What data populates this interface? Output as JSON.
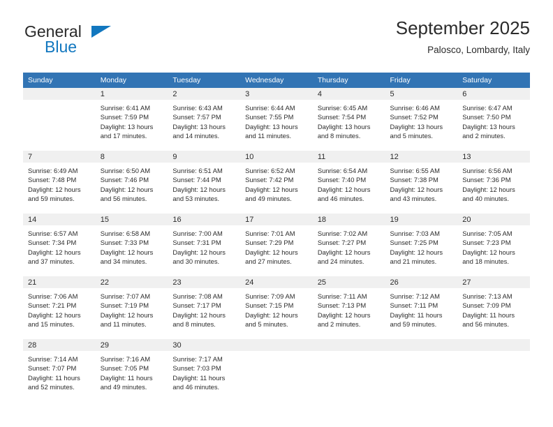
{
  "brand": {
    "word_top": "General",
    "word_bottom": "Blue",
    "triangle_color": "#1277bf",
    "text_color": "#2a2a2a"
  },
  "header": {
    "title": "September 2025",
    "subtitle": "Palosco, Lombardy, Italy"
  },
  "theme": {
    "header_blue": "#3274b4",
    "daynum_background": "#f0f0f0",
    "text": "#2b2b2b"
  },
  "weekday_headers": [
    "Sunday",
    "Monday",
    "Tuesday",
    "Wednesday",
    "Thursday",
    "Friday",
    "Saturday"
  ],
  "labels": {
    "sunrise_prefix": "Sunrise:",
    "sunset_prefix": "Sunset:",
    "daylight_prefix": "Daylight:"
  },
  "weeks": [
    [
      {
        "day": "",
        "line1": "",
        "line2": "",
        "line3": "",
        "line4": ""
      },
      {
        "day": "1",
        "line1": "Sunrise: 6:41 AM",
        "line2": "Sunset: 7:59 PM",
        "line3": "Daylight: 13 hours",
        "line4": "and 17 minutes."
      },
      {
        "day": "2",
        "line1": "Sunrise: 6:43 AM",
        "line2": "Sunset: 7:57 PM",
        "line3": "Daylight: 13 hours",
        "line4": "and 14 minutes."
      },
      {
        "day": "3",
        "line1": "Sunrise: 6:44 AM",
        "line2": "Sunset: 7:55 PM",
        "line3": "Daylight: 13 hours",
        "line4": "and 11 minutes."
      },
      {
        "day": "4",
        "line1": "Sunrise: 6:45 AM",
        "line2": "Sunset: 7:54 PM",
        "line3": "Daylight: 13 hours",
        "line4": "and 8 minutes."
      },
      {
        "day": "5",
        "line1": "Sunrise: 6:46 AM",
        "line2": "Sunset: 7:52 PM",
        "line3": "Daylight: 13 hours",
        "line4": "and 5 minutes."
      },
      {
        "day": "6",
        "line1": "Sunrise: 6:47 AM",
        "line2": "Sunset: 7:50 PM",
        "line3": "Daylight: 13 hours",
        "line4": "and 2 minutes."
      }
    ],
    [
      {
        "day": "7",
        "line1": "Sunrise: 6:49 AM",
        "line2": "Sunset: 7:48 PM",
        "line3": "Daylight: 12 hours",
        "line4": "and 59 minutes."
      },
      {
        "day": "8",
        "line1": "Sunrise: 6:50 AM",
        "line2": "Sunset: 7:46 PM",
        "line3": "Daylight: 12 hours",
        "line4": "and 56 minutes."
      },
      {
        "day": "9",
        "line1": "Sunrise: 6:51 AM",
        "line2": "Sunset: 7:44 PM",
        "line3": "Daylight: 12 hours",
        "line4": "and 53 minutes."
      },
      {
        "day": "10",
        "line1": "Sunrise: 6:52 AM",
        "line2": "Sunset: 7:42 PM",
        "line3": "Daylight: 12 hours",
        "line4": "and 49 minutes."
      },
      {
        "day": "11",
        "line1": "Sunrise: 6:54 AM",
        "line2": "Sunset: 7:40 PM",
        "line3": "Daylight: 12 hours",
        "line4": "and 46 minutes."
      },
      {
        "day": "12",
        "line1": "Sunrise: 6:55 AM",
        "line2": "Sunset: 7:38 PM",
        "line3": "Daylight: 12 hours",
        "line4": "and 43 minutes."
      },
      {
        "day": "13",
        "line1": "Sunrise: 6:56 AM",
        "line2": "Sunset: 7:36 PM",
        "line3": "Daylight: 12 hours",
        "line4": "and 40 minutes."
      }
    ],
    [
      {
        "day": "14",
        "line1": "Sunrise: 6:57 AM",
        "line2": "Sunset: 7:34 PM",
        "line3": "Daylight: 12 hours",
        "line4": "and 37 minutes."
      },
      {
        "day": "15",
        "line1": "Sunrise: 6:58 AM",
        "line2": "Sunset: 7:33 PM",
        "line3": "Daylight: 12 hours",
        "line4": "and 34 minutes."
      },
      {
        "day": "16",
        "line1": "Sunrise: 7:00 AM",
        "line2": "Sunset: 7:31 PM",
        "line3": "Daylight: 12 hours",
        "line4": "and 30 minutes."
      },
      {
        "day": "17",
        "line1": "Sunrise: 7:01 AM",
        "line2": "Sunset: 7:29 PM",
        "line3": "Daylight: 12 hours",
        "line4": "and 27 minutes."
      },
      {
        "day": "18",
        "line1": "Sunrise: 7:02 AM",
        "line2": "Sunset: 7:27 PM",
        "line3": "Daylight: 12 hours",
        "line4": "and 24 minutes."
      },
      {
        "day": "19",
        "line1": "Sunrise: 7:03 AM",
        "line2": "Sunset: 7:25 PM",
        "line3": "Daylight: 12 hours",
        "line4": "and 21 minutes."
      },
      {
        "day": "20",
        "line1": "Sunrise: 7:05 AM",
        "line2": "Sunset: 7:23 PM",
        "line3": "Daylight: 12 hours",
        "line4": "and 18 minutes."
      }
    ],
    [
      {
        "day": "21",
        "line1": "Sunrise: 7:06 AM",
        "line2": "Sunset: 7:21 PM",
        "line3": "Daylight: 12 hours",
        "line4": "and 15 minutes."
      },
      {
        "day": "22",
        "line1": "Sunrise: 7:07 AM",
        "line2": "Sunset: 7:19 PM",
        "line3": "Daylight: 12 hours",
        "line4": "and 11 minutes."
      },
      {
        "day": "23",
        "line1": "Sunrise: 7:08 AM",
        "line2": "Sunset: 7:17 PM",
        "line3": "Daylight: 12 hours",
        "line4": "and 8 minutes."
      },
      {
        "day": "24",
        "line1": "Sunrise: 7:09 AM",
        "line2": "Sunset: 7:15 PM",
        "line3": "Daylight: 12 hours",
        "line4": "and 5 minutes."
      },
      {
        "day": "25",
        "line1": "Sunrise: 7:11 AM",
        "line2": "Sunset: 7:13 PM",
        "line3": "Daylight: 12 hours",
        "line4": "and 2 minutes."
      },
      {
        "day": "26",
        "line1": "Sunrise: 7:12 AM",
        "line2": "Sunset: 7:11 PM",
        "line3": "Daylight: 11 hours",
        "line4": "and 59 minutes."
      },
      {
        "day": "27",
        "line1": "Sunrise: 7:13 AM",
        "line2": "Sunset: 7:09 PM",
        "line3": "Daylight: 11 hours",
        "line4": "and 56 minutes."
      }
    ],
    [
      {
        "day": "28",
        "line1": "Sunrise: 7:14 AM",
        "line2": "Sunset: 7:07 PM",
        "line3": "Daylight: 11 hours",
        "line4": "and 52 minutes."
      },
      {
        "day": "29",
        "line1": "Sunrise: 7:16 AM",
        "line2": "Sunset: 7:05 PM",
        "line3": "Daylight: 11 hours",
        "line4": "and 49 minutes."
      },
      {
        "day": "30",
        "line1": "Sunrise: 7:17 AM",
        "line2": "Sunset: 7:03 PM",
        "line3": "Daylight: 11 hours",
        "line4": "and 46 minutes."
      },
      {
        "day": "",
        "line1": "",
        "line2": "",
        "line3": "",
        "line4": ""
      },
      {
        "day": "",
        "line1": "",
        "line2": "",
        "line3": "",
        "line4": ""
      },
      {
        "day": "",
        "line1": "",
        "line2": "",
        "line3": "",
        "line4": ""
      },
      {
        "day": "",
        "line1": "",
        "line2": "",
        "line3": "",
        "line4": ""
      }
    ]
  ]
}
